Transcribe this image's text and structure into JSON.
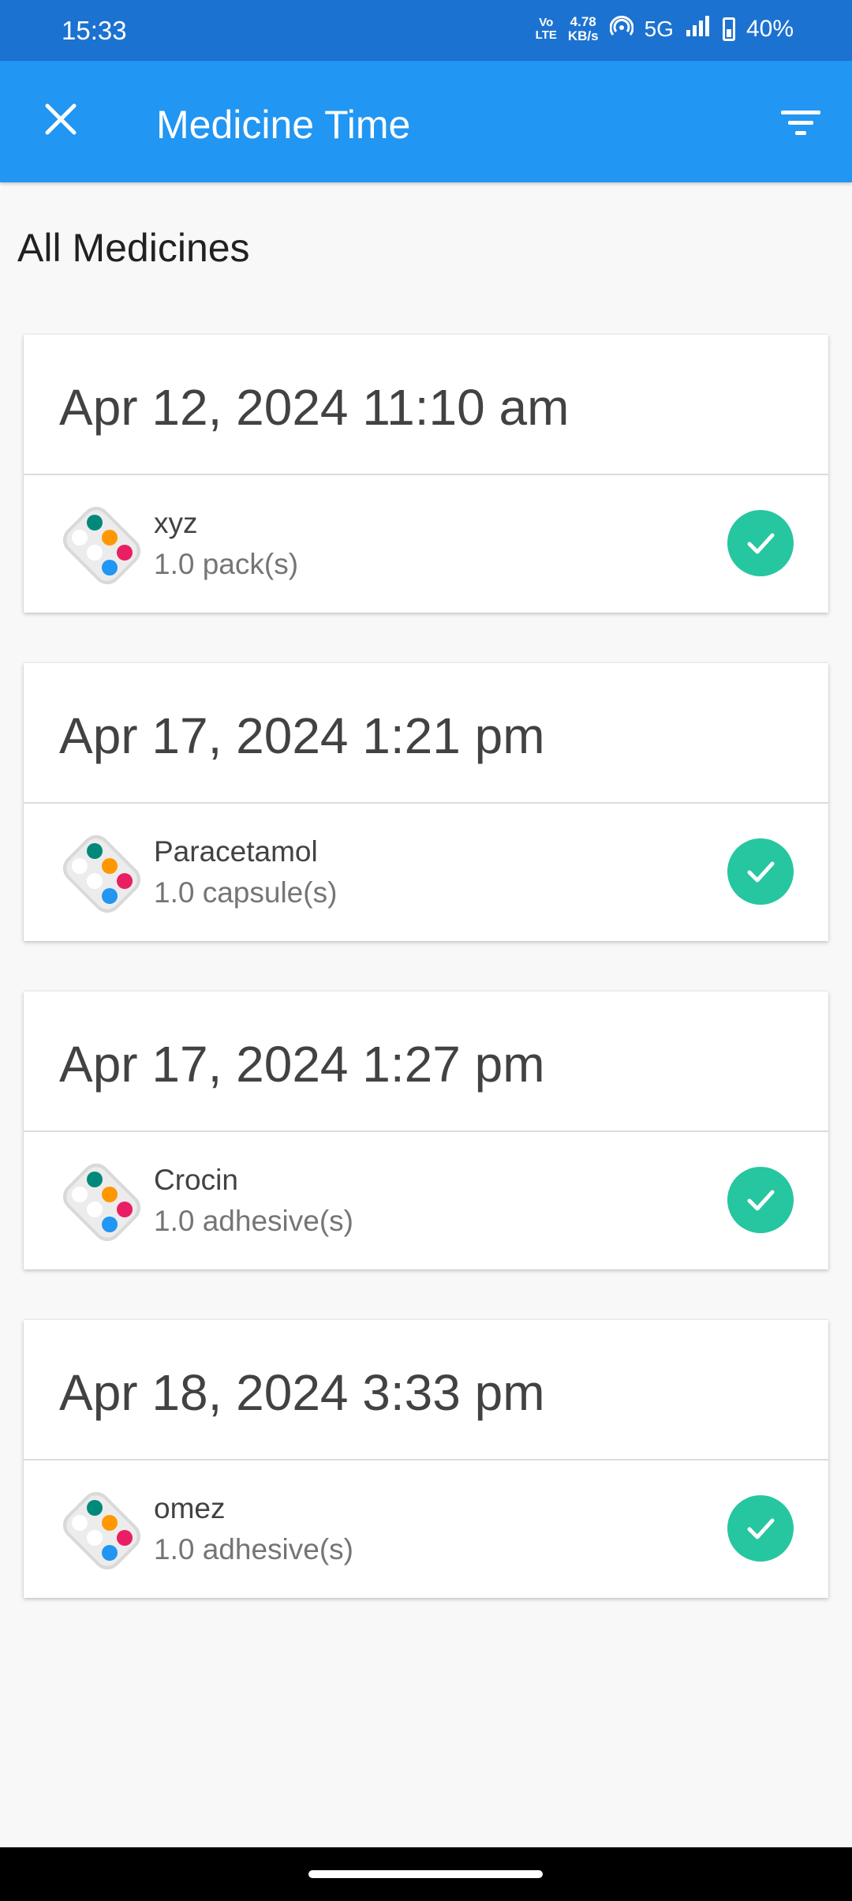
{
  "status_bar": {
    "time": "15:33",
    "volte": "Vo\nLTE",
    "speed": "4.78\nKB/s",
    "network": "5G",
    "battery": "40%"
  },
  "app_bar": {
    "title": "Medicine Time",
    "close_icon": "close-icon",
    "filter_icon": "filter-icon"
  },
  "section_title": "All Medicines",
  "medicines": [
    {
      "date": "Apr 12, 2024 11:10 am",
      "name": "xyz",
      "dose": "1.0 pack(s)"
    },
    {
      "date": "Apr 17, 2024 1:21 pm",
      "name": "Paracetamol",
      "dose": "1.0 capsule(s)"
    },
    {
      "date": "Apr 17, 2024 1:27 pm",
      "name": "Crocin",
      "dose": "1.0 adhesive(s)"
    },
    {
      "date": "Apr 18, 2024 3:33 pm",
      "name": "omez",
      "dose": "1.0 adhesive(s)"
    }
  ],
  "colors": {
    "status_bar": "#1c72d0",
    "app_bar": "#2196f3",
    "check": "#26c6a0"
  }
}
